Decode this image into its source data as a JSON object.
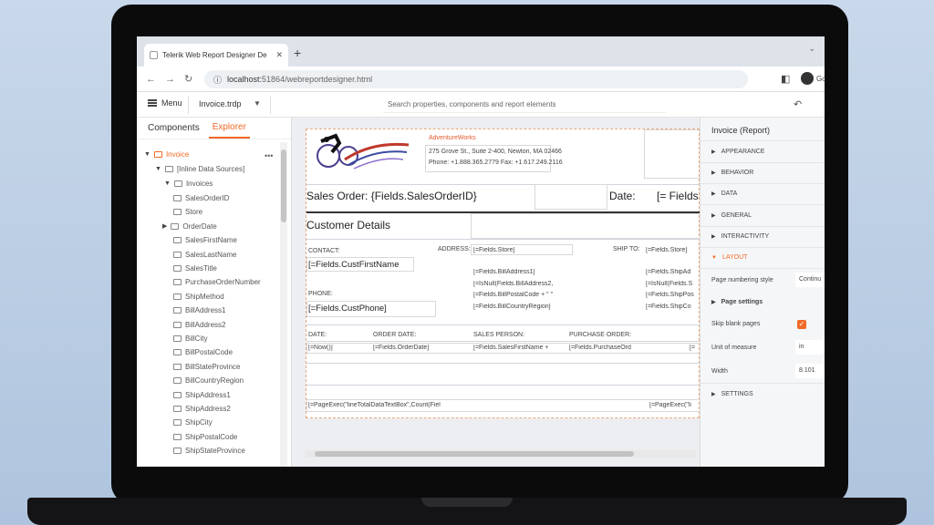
{
  "browser": {
    "tab_title": "Telerik Web Report Designer De",
    "new_tab": "+",
    "url_host": "localhost:",
    "url_path": "51864/webreportdesigner.html",
    "profile_text": "Go"
  },
  "toolbar": {
    "menu_label": "Menu",
    "file_name": "Invoice.trdp",
    "search_placeholder": "Search properties, components and report elements"
  },
  "left_panel": {
    "tabs": [
      "Components",
      "Explorer"
    ],
    "tree": {
      "root": "Invoice",
      "datasources": "[Inline Data Sources]",
      "invoices": "Invoices",
      "fields": [
        "SalesOrderID",
        "Store",
        "OrderDate",
        "SalesFirstName",
        "SalesLastName",
        "SalesTitle",
        "PurchaseOrderNumber",
        "ShipMethod",
        "BillAddress1",
        "BillAddress2",
        "BillCity",
        "BillPostalCode",
        "BillStateProvince",
        "BillCountryRegion",
        "ShipAddress1",
        "ShipAddress2",
        "ShipCity",
        "ShipPostalCode",
        "ShipStateProvince"
      ]
    }
  },
  "report": {
    "company": "AdventureWorks",
    "address_line": "275 Grove St., Suite 2-400, Newton, MA 02466",
    "phone_line": "Phone: +1.888.365.2779 Fax: +1.617.249.2116",
    "sales_order": "Sales Order: {Fields.SalesOrderID}",
    "date_label": "Date:",
    "date_field": "[= Fields",
    "customer_details": "Customer Details",
    "contact_label": "CONTACT:",
    "address_label": "ADDRESS:",
    "store_field": "[=Fields.Store]",
    "shipto_label": "SHIP TO:",
    "shipto_store": "[=Fields.Store]",
    "cust_first_name": "[=Fields.CustFirstName",
    "bill_address1": "[=Fields.BillAddress1]",
    "bill_isnull": "[=IsNull(Fields.BillAddress2,",
    "bill_postal": "[=Fields.BillPostalCode + \" \"",
    "bill_country": "[=Fields.BillCountryRegion]",
    "ship_address": "[=Fields.ShipAd",
    "ship_isnull": "[=IsNull(Fields.S",
    "ship_postal": "[=Fields.ShipPos",
    "ship_country": "[=Fields.ShipCo",
    "phone_label": "PHONE:",
    "cust_phone": "[=Fields.CustPhone]",
    "col_date": "DATE:",
    "col_order_date": "ORDER DATE:",
    "col_sales_person": "SALES PERSON:",
    "col_purchase_order": "PURCHASE ORDER:",
    "val_now": "[=Now()]",
    "val_order_date": "[=Fields.OrderDate]",
    "val_sales_person": "[=Fields.SalesFirstName +",
    "val_purchase_order": "[=Fields.PurchaseOrd",
    "val_extra": "[=",
    "page_exec": "[=PageExec(\"lineTotalDataTextBox\",Count(Fiel",
    "page_exec_right": "[=PageExec(\"li"
  },
  "right_panel": {
    "title": "Invoice (Report)",
    "sections": [
      "APPEARANCE",
      "BEHAVIOR",
      "DATA",
      "GENERAL",
      "INTERACTIVITY",
      "LAYOUT"
    ],
    "page_numbering_label": "Page numbering style",
    "page_numbering_value": "Continu",
    "page_settings": "Page settings",
    "skip_blank_label": "Skip blank pages",
    "unit_label": "Unit of measure",
    "unit_value": "in",
    "width_label": "Width",
    "width_value": "8.101",
    "settings": "SETTINGS"
  },
  "colors": {
    "accent": "#f06a27",
    "logo_blue": "#2b1cff"
  }
}
